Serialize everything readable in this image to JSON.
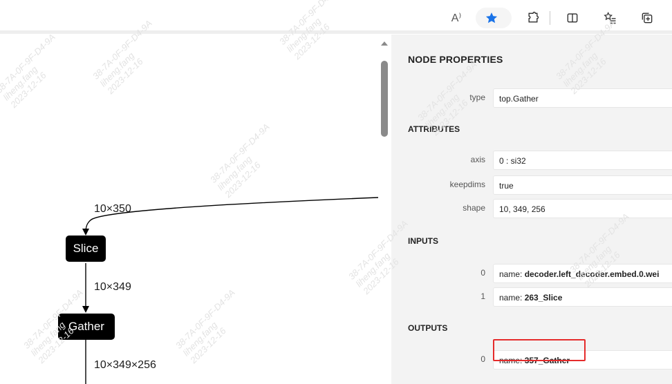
{
  "toolbar": {
    "icons": [
      "read-aloud-icon",
      "favorite-star-icon",
      "extensions-icon",
      "split-screen-icon",
      "favorites-list-icon",
      "collections-icon"
    ],
    "read_aloud_glyph": "A⁾",
    "accent_color": "#1a73e8"
  },
  "graph": {
    "edge_labels": {
      "input_to_slice": "10×350",
      "slice_to_gather": "10×349",
      "gather_out": "10×349×256"
    },
    "nodes": {
      "slice": "Slice",
      "gather": "Gather"
    }
  },
  "panel": {
    "title": "NODE PROPERTIES",
    "type": {
      "key": "type",
      "value": "top.Gather"
    },
    "attributes_heading": "ATTRIBUTES",
    "attributes": [
      {
        "key": "axis",
        "value": "0 : si32"
      },
      {
        "key": "keepdims",
        "value": "true"
      },
      {
        "key": "shape",
        "value": "10, 349, 256"
      }
    ],
    "inputs_heading": "INPUTS",
    "inputs": [
      {
        "key": "0",
        "prefix": "name: ",
        "value": "decoder.left_decoder.embed.0.wei"
      },
      {
        "key": "1",
        "prefix": "name: ",
        "value": "263_Slice"
      }
    ],
    "outputs_heading": "OUTPUTS",
    "outputs": [
      {
        "key": "0",
        "prefix": "name: ",
        "value": "357_Gather"
      }
    ]
  },
  "watermark": {
    "line1": "38-7A-0F-9F-D4-9A",
    "line2": "liheng.fang",
    "line3": "2023-12-16"
  }
}
